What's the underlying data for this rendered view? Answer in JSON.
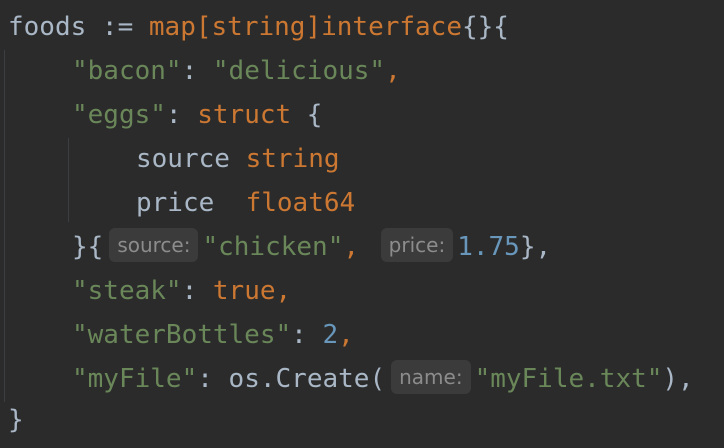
{
  "code": {
    "l1": {
      "var": "foods",
      "op": " := ",
      "map": "map",
      "lb": "[",
      "string": "string",
      "rb": "]",
      "iface": "interface",
      "tail": "{}{"
    },
    "l2": {
      "key": "\"bacon\"",
      "colon": ": ",
      "val": "\"delicious\"",
      "comma": ","
    },
    "l3": {
      "key": "\"eggs\"",
      "colon": ": ",
      "kw": "struct",
      "brace": " {"
    },
    "l4": {
      "field": "source",
      "type": "string"
    },
    "l5": {
      "field": "price",
      "type": "float64"
    },
    "l6": {
      "open": "}{",
      "hint1": "source:",
      "val1": "\"chicken\"",
      "comma1": ",",
      "hint2": "price:",
      "val2": "1.75",
      "close": "},"
    },
    "l7": {
      "key": "\"steak\"",
      "colon": ": ",
      "val": "true",
      "comma": ","
    },
    "l8": {
      "key": "\"waterBottles\"",
      "colon": ": ",
      "val": "2",
      "comma": ","
    },
    "l9": {
      "key": "\"myFile\"",
      "colon": ": ",
      "pkg": "os",
      "dot": ".",
      "fn": "Create",
      "paren": "(",
      "hint": "name:",
      "val": "\"myFile.txt\"",
      "close": "),"
    },
    "l10": {
      "brace": "}"
    }
  },
  "colors": {
    "background": "#2b2b2b",
    "keyword": "#cc7832",
    "string": "#6a8759",
    "number": "#6897bb",
    "identifier": "#a9b7c6",
    "hint_bg": "#3b3b3b",
    "hint_text": "#8c8c8c"
  }
}
